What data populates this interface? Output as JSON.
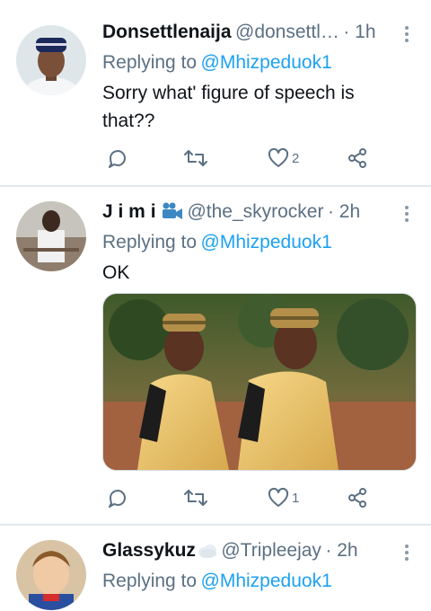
{
  "tweets": [
    {
      "display_name": "Donsettlenaija",
      "handle": "@donsettl…",
      "time": "· 1h",
      "replying_prefix": "Replying to",
      "replying_to": "@Mhizpeduok1",
      "text": "Sorry what' figure of speech is that??",
      "reply_count": "",
      "retweet_count": "",
      "like_count": "2"
    },
    {
      "display_name": "J i m i",
      "name_emoji": "movie-camera-emoji",
      "handle": "@the_skyrocker",
      "time": "· 2h",
      "replying_prefix": "Replying to",
      "replying_to": "@Mhizpeduok1",
      "text": "OK",
      "has_media": true,
      "reply_count": "",
      "retweet_count": "",
      "like_count": "1"
    },
    {
      "display_name": "Glassykuz",
      "name_emoji": "cloud-emoji",
      "handle": "@Tripleejay",
      "time": "· 2h",
      "replying_prefix": "Replying to",
      "replying_to": "@Mhizpeduok1"
    }
  ],
  "colors": {
    "link": "#1da1f2",
    "muted": "#5b7083",
    "divider": "#e1e8ed"
  },
  "icons": [
    "reply-icon",
    "retweet-icon",
    "like-icon",
    "share-icon",
    "more-options-icon"
  ]
}
